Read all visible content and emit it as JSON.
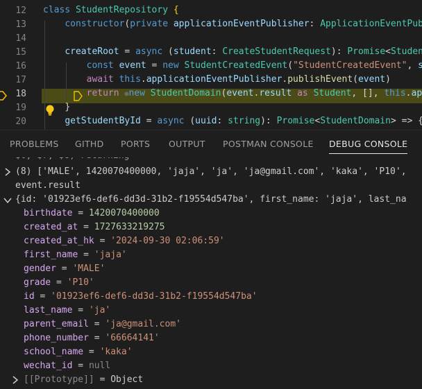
{
  "editor": {
    "lines": [
      {
        "num": "12",
        "tokens": [
          [
            "kw",
            "class "
          ],
          [
            "ty",
            "StudentRepository"
          ],
          [
            "p",
            " "
          ],
          [
            "br",
            "{"
          ]
        ]
      },
      {
        "num": "13",
        "tokens": [
          [
            "ind",
            "    "
          ],
          [
            "kw",
            "constructor"
          ],
          [
            "p",
            "("
          ],
          [
            "kw",
            "private "
          ],
          [
            "vr",
            "applicationEventPublisher"
          ],
          [
            "p",
            ": "
          ],
          [
            "ty",
            "ApplicationEventPubli"
          ]
        ]
      },
      {
        "num": "14",
        "tokens": []
      },
      {
        "num": "15",
        "tokens": [
          [
            "ind",
            "    "
          ],
          [
            "vr",
            "createRoot"
          ],
          [
            "p",
            " = "
          ],
          [
            "kw",
            "async "
          ],
          [
            "p",
            "("
          ],
          [
            "vr",
            "student"
          ],
          [
            "p",
            ": "
          ],
          [
            "ty",
            "CreateStudentRequest"
          ],
          [
            "p",
            "): "
          ],
          [
            "ty",
            "Promise"
          ],
          [
            "p",
            "<"
          ],
          [
            "ty",
            "StudentD"
          ]
        ]
      },
      {
        "num": "16",
        "tokens": [
          [
            "ind",
            "        "
          ],
          [
            "kw",
            "const "
          ],
          [
            "vr",
            "event"
          ],
          [
            "p",
            " = "
          ],
          [
            "kw",
            "new "
          ],
          [
            "ty",
            "StudentCreatedEvent"
          ],
          [
            "p",
            "("
          ],
          [
            "st",
            "\"StudentCreatedEvent\""
          ],
          [
            "p",
            ", "
          ],
          [
            "vr",
            "stu"
          ]
        ]
      },
      {
        "num": "17",
        "tokens": [
          [
            "ind",
            "        "
          ],
          [
            "ctl",
            "await "
          ],
          [
            "kw",
            "this"
          ],
          [
            "p",
            "."
          ],
          [
            "vr",
            "applicationEventPublisher"
          ],
          [
            "p",
            "."
          ],
          [
            "fn",
            "publishEvent"
          ],
          [
            "p",
            "("
          ],
          [
            "vr",
            "event"
          ],
          [
            "p",
            ")"
          ]
        ]
      },
      {
        "num": "18",
        "tokens": [
          [
            "ind",
            "        "
          ],
          [
            "ctl",
            "return "
          ],
          [
            "pg",
            "●"
          ],
          [
            "kw",
            "new "
          ],
          [
            "ty",
            "StudentDomain"
          ],
          [
            "p",
            "("
          ],
          [
            "vr",
            "event"
          ],
          [
            "p",
            "."
          ],
          [
            "vr",
            "result"
          ],
          [
            "p",
            " "
          ],
          [
            "ctl",
            "as "
          ],
          [
            "ty",
            "Student"
          ],
          [
            "p",
            ", [], "
          ],
          [
            "kw",
            "this"
          ],
          [
            "p",
            "."
          ],
          [
            "vr",
            "app"
          ]
        ]
      },
      {
        "num": "19",
        "tokens": [
          [
            "ind",
            "    "
          ],
          [
            "p",
            "}"
          ]
        ]
      },
      {
        "num": "20",
        "tokens": [
          [
            "ind",
            "    "
          ],
          [
            "vr",
            "getStudentById"
          ],
          [
            "p",
            " = "
          ],
          [
            "kw",
            "async "
          ],
          [
            "p",
            "("
          ],
          [
            "vr",
            "uuid"
          ],
          [
            "p",
            ": "
          ],
          [
            "ty",
            "string"
          ],
          [
            "p",
            "): "
          ],
          [
            "ty",
            "Promise"
          ],
          [
            "p",
            "<"
          ],
          [
            "ty",
            "StudentDomain"
          ],
          [
            "p",
            "> => {"
          ]
        ]
      }
    ],
    "top_partial": "3"
  },
  "panel": {
    "tabs": [
      "PROBLEMS",
      "GITHD",
      "PORTS",
      "OUTPUT",
      "POSTMAN CONSOLE",
      "DEBUG CONSOLE"
    ],
    "active": "DEBUG CONSOLE"
  },
  "console": {
    "top_partial": "$6, $7, $8) returning *",
    "array_line": "(8) ['MALE', 1420070400000, 'jaja', 'ja', 'ja@gmail.com', 'kaka', 'P10',",
    "expr": "event.result",
    "object_summary": "{id: '01923ef6-def6-dd3d-31b2-f19554d547ba', first_name: 'jaja', last_na",
    "props": [
      {
        "k": "birthdate",
        "v": "1420070400000",
        "t": "n"
      },
      {
        "k": "created_at",
        "v": "1727633219275",
        "t": "n"
      },
      {
        "k": "created_at_hk",
        "v": "'2024-09-30 02:06:59'",
        "t": "s"
      },
      {
        "k": "first_name",
        "v": "'jaja'",
        "t": "s"
      },
      {
        "k": "gender",
        "v": "'MALE'",
        "t": "s"
      },
      {
        "k": "grade",
        "v": "'P10'",
        "t": "s"
      },
      {
        "k": "id",
        "v": "'01923ef6-def6-dd3d-31b2-f19554d547ba'",
        "t": "s"
      },
      {
        "k": "last_name",
        "v": "'ja'",
        "t": "s"
      },
      {
        "k": "parent_email",
        "v": "'ja@gmail.com'",
        "t": "s"
      },
      {
        "k": "phone_number",
        "v": "'66664141'",
        "t": "s"
      },
      {
        "k": "school_name",
        "v": "'kaka'",
        "t": "s"
      },
      {
        "k": "wechat_id",
        "v": "null",
        "t": "g"
      }
    ],
    "prototype_key": "[[Prototype]]",
    "prototype_val": "Object",
    "eq": " = "
  }
}
